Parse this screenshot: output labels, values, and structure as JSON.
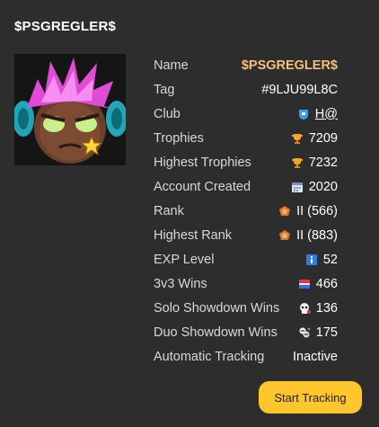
{
  "player_title": "$PSGREGLER$",
  "colors": {
    "background": "#2d2d2d",
    "name_gold": "#f1c27a",
    "button": "#fec52c"
  },
  "avatar": {
    "icon": "brawler-portrait-icon"
  },
  "stats": [
    {
      "label": "Name",
      "value": "$PSGREGLER$",
      "icon": ""
    },
    {
      "label": "Tag",
      "value": "#9LJU99L8C",
      "icon": ""
    },
    {
      "label": "Club",
      "value": "H@",
      "icon": "club-badge-icon"
    },
    {
      "label": "Trophies",
      "value": "7209",
      "icon": "trophy-icon"
    },
    {
      "label": "Highest Trophies",
      "value": "7232",
      "icon": "trophy-icon"
    },
    {
      "label": "Account Created",
      "value": "2020",
      "icon": "calendar-icon"
    },
    {
      "label": "Rank",
      "value": "II (566)",
      "icon": "rank-icon"
    },
    {
      "label": "Highest Rank",
      "value": "II (883)",
      "icon": "rank-icon"
    },
    {
      "label": "EXP Level",
      "value": "52",
      "icon": "exp-info-icon"
    },
    {
      "label": "3v3 Wins",
      "value": "466",
      "icon": "3v3-icon"
    },
    {
      "label": "Solo Showdown Wins",
      "value": "136",
      "icon": "skull-icon"
    },
    {
      "label": "Duo Showdown Wins",
      "value": "175",
      "icon": "duo-showdown-icon"
    },
    {
      "label": "Automatic Tracking",
      "value": "Inactive",
      "icon": ""
    }
  ],
  "button": {
    "label": "Start Tracking"
  }
}
